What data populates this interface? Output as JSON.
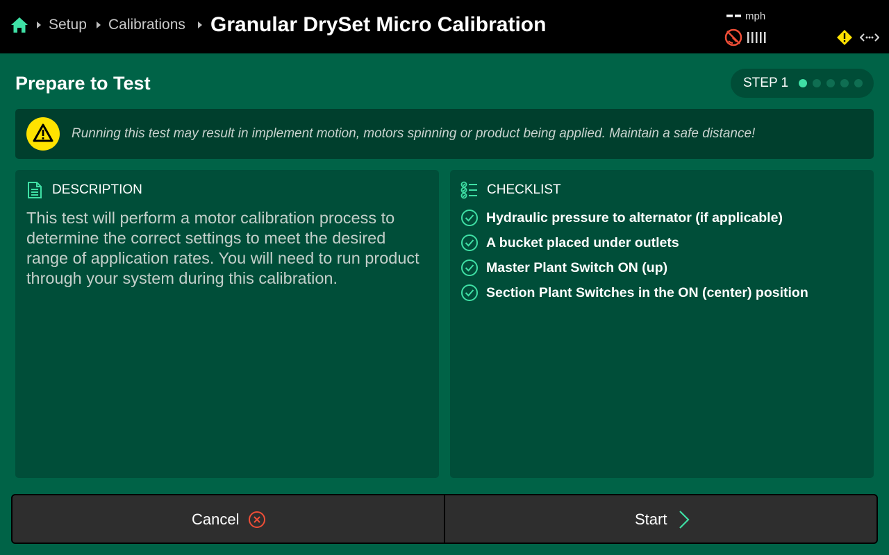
{
  "header": {
    "breadcrumbs": [
      "Setup",
      "Calibrations"
    ],
    "title": "Granular DrySet Micro Calibration",
    "speed_value": "--",
    "speed_unit": "mph",
    "icons": [
      "home-icon",
      "gps-off-icon",
      "signal-bars-icon",
      "warning-icon",
      "connection-icon"
    ]
  },
  "step": {
    "title": "Prepare to Test",
    "label": "STEP 1",
    "current": 1,
    "total": 5
  },
  "warning": {
    "text": "Running this test may result in implement motion, motors spinning or product being applied. Maintain a safe distance!"
  },
  "description": {
    "heading": "DESCRIPTION",
    "body": "This test will perform a motor calibration process to determine the correct settings to meet the desired range of application rates. You will need to run product through your system during this calibration."
  },
  "checklist": {
    "heading": "CHECKLIST",
    "items": [
      "Hydraulic pressure to alternator (if applicable)",
      "A bucket placed under outlets",
      "Master Plant Switch ON (up)",
      "Section Plant Switches in the ON (center) position"
    ]
  },
  "buttons": {
    "cancel": "Cancel",
    "start": "Start"
  },
  "colors": {
    "background": "#006347",
    "panel": "#004e39",
    "accent": "#3fe0a5",
    "warning_yellow": "#ffe200",
    "alert_red": "#f04e37",
    "button": "#2e2e2e"
  }
}
